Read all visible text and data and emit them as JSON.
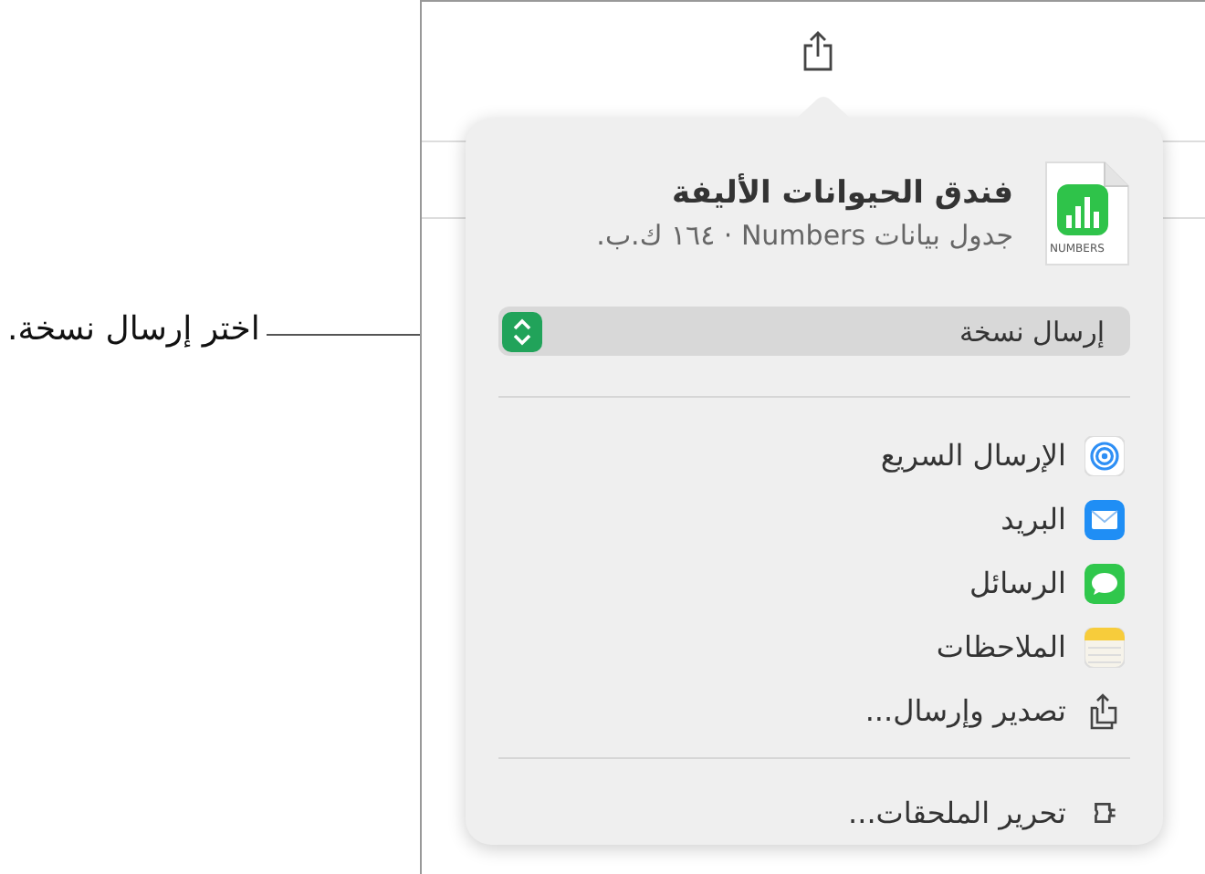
{
  "document": {
    "title": "فندق الحيوانات الأليفة",
    "subtitle": "جدول بيانات Numbers · ١٦٤ ك.ب.",
    "icon_label": "NUMBERS"
  },
  "send_menu": {
    "value": "إرسال نسخة"
  },
  "items": [
    {
      "kind": "airdrop",
      "label": "الإرسال السريع"
    },
    {
      "kind": "mail",
      "label": "البريد"
    },
    {
      "kind": "messages",
      "label": "الرسائل"
    },
    {
      "kind": "notes",
      "label": "الملاحظات"
    },
    {
      "kind": "export",
      "label": "تصدير وإرسال..."
    }
  ],
  "footer_item": {
    "label": "تحرير الملحقات..."
  },
  "callout": "اختر إرسال نسخة."
}
